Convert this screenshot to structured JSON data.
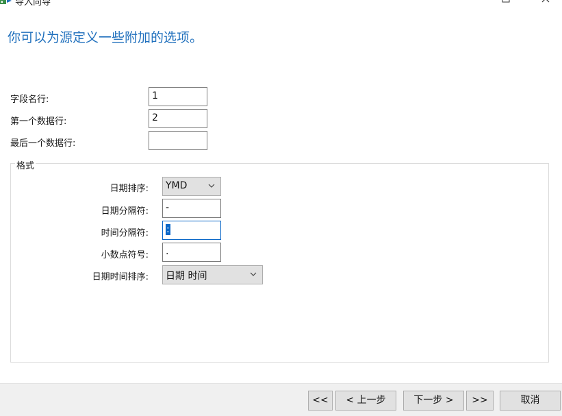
{
  "window": {
    "title": "导入向导",
    "icon": "import-wizard-icon",
    "maximize_icon": "maximize-icon",
    "close_icon": "close-icon"
  },
  "heading": "你可以为源定义一些附加的选项。",
  "fields": {
    "field_name_row": {
      "label": "字段名行:",
      "value": "1"
    },
    "first_data_row": {
      "label": "第一个数据行:",
      "value": "2"
    },
    "last_data_row": {
      "label": "最后一个数据行:",
      "value": ""
    }
  },
  "format": {
    "title": "格式",
    "date_order": {
      "label": "日期排序:",
      "value": "YMD"
    },
    "date_separator": {
      "label": "日期分隔符:",
      "value": "-"
    },
    "time_separator": {
      "label": "时间分隔符:",
      "value": ":"
    },
    "decimal_symbol": {
      "label": "小数点符号:",
      "value": "."
    },
    "datetime_order": {
      "label": "日期时间排序:",
      "value": "日期 时间"
    }
  },
  "buttons": {
    "first": "<<",
    "prev": "< 上一步",
    "next": "下一步 >",
    "last": ">>",
    "cancel": "取消"
  },
  "colors": {
    "heading": "#2070bd",
    "focus_border": "#0a67c8",
    "footer_bg": "#f0f0f0",
    "button_bg": "#e1e1e1"
  }
}
